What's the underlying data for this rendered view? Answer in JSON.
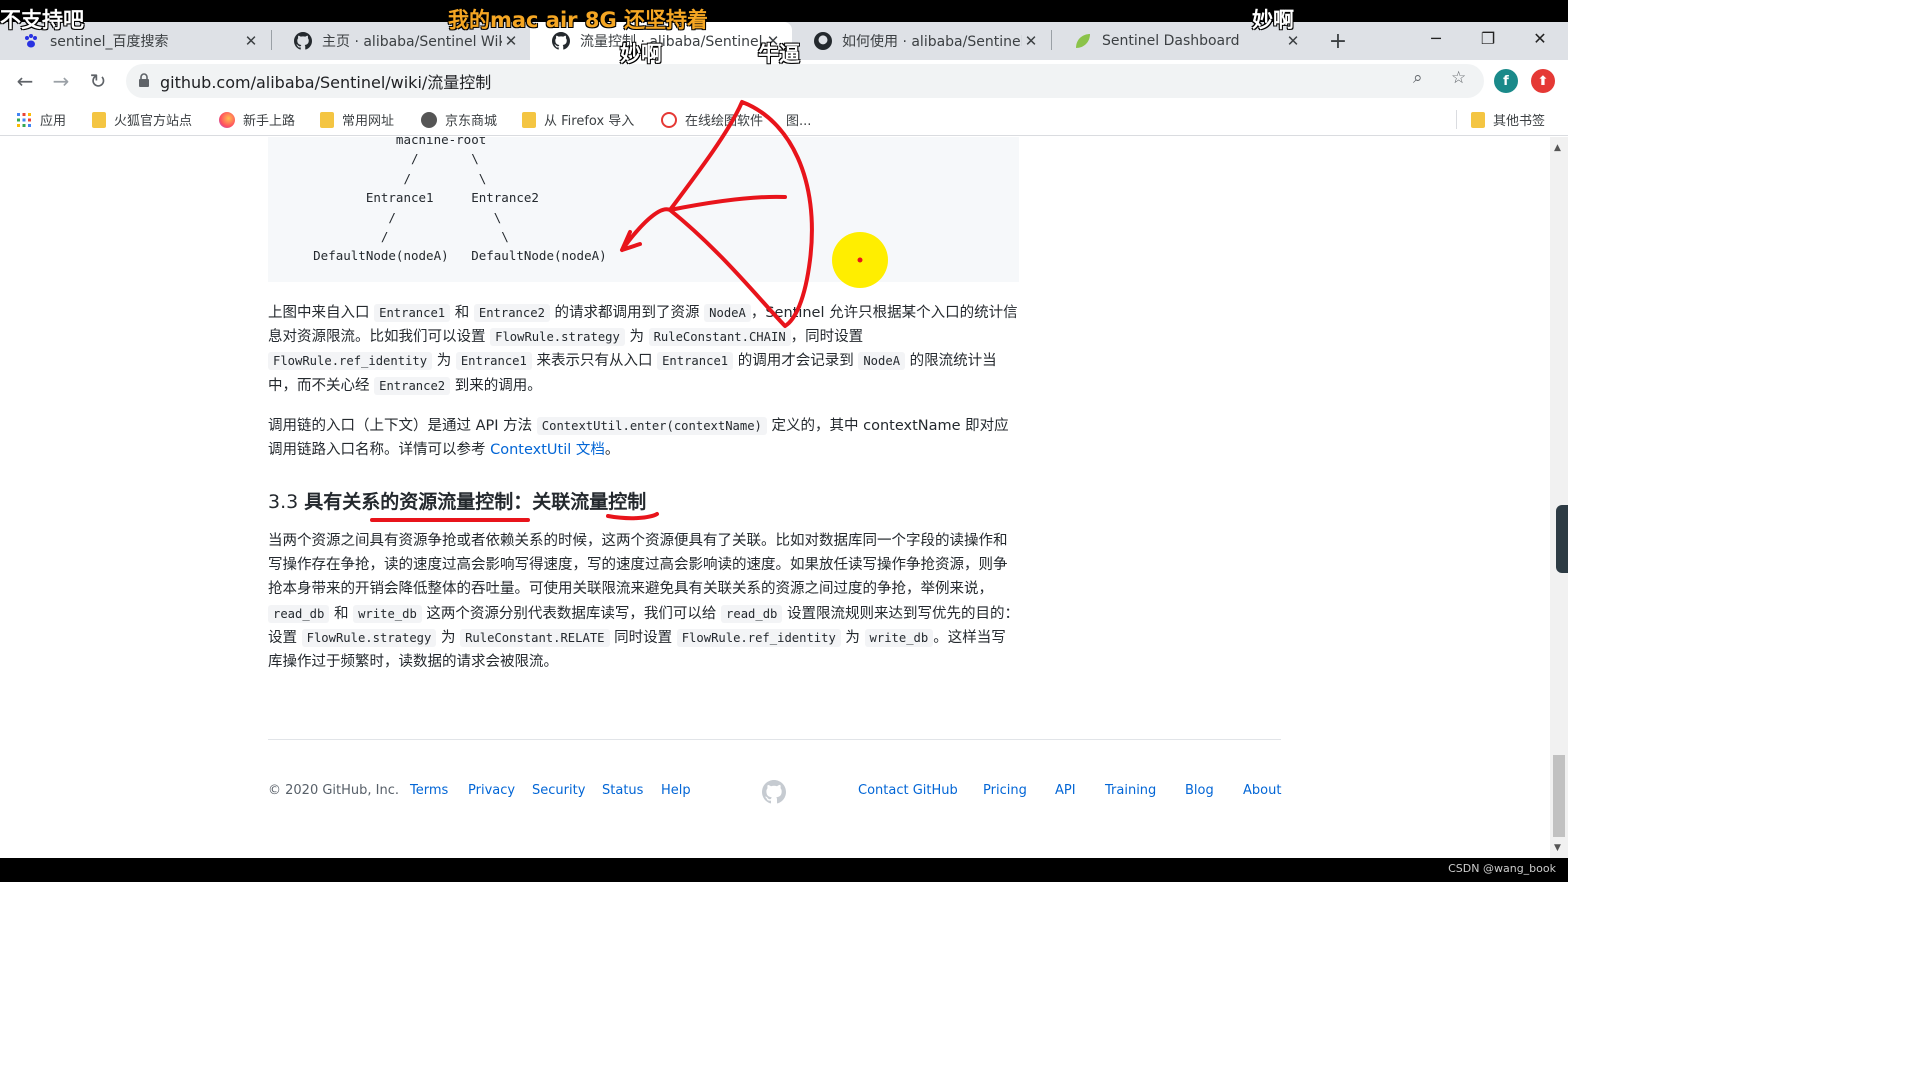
{
  "tabs": [
    {
      "title": "sentinel_百度搜索",
      "icon": "baidu-paw-icon",
      "active": false
    },
    {
      "title": "主页 · alibaba/Sentinel Wiki",
      "icon": "github-icon",
      "active": false
    },
    {
      "title": "流量控制 · alibaba/Sentinel Wiki",
      "icon": "github-icon",
      "active": true
    },
    {
      "title": "如何使用 · alibaba/Sentinel Wiki",
      "icon": "github-icon",
      "active": false
    },
    {
      "title": "Sentinel Dashboard",
      "icon": "spring-leaf-icon",
      "active": false
    }
  ],
  "window": {
    "new_tab": "+",
    "minimize": "─",
    "restore": "❐",
    "close": "✕"
  },
  "address_bar": {
    "url": "github.com/alibaba/Sentinel/wiki/流量控制",
    "avatar_letter": "f",
    "avatar_color": "#1a8a8a",
    "ext_color": "#e53935"
  },
  "bookmarks": [
    {
      "label": "应用",
      "icon": "apps-grid-icon"
    },
    {
      "label": "火狐官方站点",
      "icon": "folder-icon"
    },
    {
      "label": "新手上路",
      "icon": "firefox-icon"
    },
    {
      "label": "常用网址",
      "icon": "folder-icon"
    },
    {
      "label": "京东商城",
      "icon": "globe-icon"
    },
    {
      "label": "从 Firefox 导入",
      "icon": "folder-icon"
    },
    {
      "label": "在线绘图软件",
      "icon": "drawio-icon"
    },
    {
      "label": "图...",
      "icon": "folder-icon"
    },
    {
      "label": "其他书签",
      "icon": "folder-icon"
    }
  ],
  "code_tree": "                 machine-root\n                   /       \\\n                  /         \\\n             Entrance1     Entrance2\n                /             \\\n               /               \\\n      DefaultNode(nodeA)   DefaultNode(nodeA)",
  "para1": {
    "t1": "上图中来自入口 ",
    "c1": "Entrance1",
    "t2": " 和 ",
    "c2": "Entrance2",
    "t3": " 的请求都调用到了资源 ",
    "c3": "NodeA",
    "t4": "，Sentinel 允许只根据某个入口的统计信息对资源限流。比如我们可以设置 ",
    "c4": "FlowRule.strategy",
    "t5": " 为 ",
    "c5": "RuleConstant.CHAIN",
    "t6": "，同时设置 ",
    "c6": "FlowRule.ref_identity",
    "t7": " 为 ",
    "c7": "Entrance1",
    "t8": " 来表示只有从入口 ",
    "c8": "Entrance1",
    "t9": " 的调用才会记录到 ",
    "c9": "NodeA",
    "t10": " 的限流统计当中，而不关心经 ",
    "c10": "Entrance2",
    "t11": " 到来的调用。"
  },
  "para2": {
    "t1": "调用链的入口（上下文）是通过 API 方法 ",
    "c1": "ContextUtil.enter(contextName)",
    "t2": " 定义的，其中 contextName 即对应调用链路入口名称。详情可以参考 ",
    "link": "ContextUtil 文档",
    "t3": "。"
  },
  "heading": {
    "number": "3.3 ",
    "title": "具有关系的资源流量控制：关联流量控制"
  },
  "para3": {
    "t1": "当两个资源之间具有资源争抢或者依赖关系的时候，这两个资源便具有了关联。比如对数据库同一个字段的读操作和写操作存在争抢，读的速度过高会影响写得速度，写的速度过高会影响读的速度。如果放任读写操作争抢资源，则争抢本身带来的开销会降低整体的吞吐量。可使用关联限流来避免具有关联关系的资源之间过度的争抢，举例来说，",
    "c1": "read_db",
    "t2": " 和 ",
    "c2": "write_db",
    "t3": " 这两个资源分别代表数据库读写，我们可以给 ",
    "c3": "read_db",
    "t4": " 设置限流规则来达到写优先的目的：设置 ",
    "c4": "FlowRule.strategy",
    "t5": " 为 ",
    "c5": "RuleConstant.RELATE",
    "t6": " 同时设置 ",
    "c6": "FlowRule.ref_identity",
    "t7": " 为 ",
    "c7": "write_db",
    "t8": "。这样当写库操作过于频繁时，读数据的请求会被限流。"
  },
  "footer": {
    "copyright": "© 2020 GitHub, Inc.",
    "left_links": [
      "Terms",
      "Privacy",
      "Security",
      "Status",
      "Help"
    ],
    "right_links": [
      "Contact GitHub",
      "Pricing",
      "API",
      "Training",
      "Blog",
      "About"
    ]
  },
  "danmaku": [
    {
      "text": "不支持吧",
      "color": "#ffffff"
    },
    {
      "text": "我的mac air 8G 还坚持着",
      "color": "#f5a623"
    },
    {
      "text": "妙啊",
      "color": "#ffffff"
    },
    {
      "text": "妙啊",
      "color": "#ffffff"
    },
    {
      "text": "牛逼",
      "color": "#ffffff"
    }
  ],
  "watermark": "CSDN @wang_book",
  "colors": {
    "annotation_red": "#e8141b",
    "cursor_yellow": "#ffee00",
    "link_blue": "#0366d6"
  }
}
